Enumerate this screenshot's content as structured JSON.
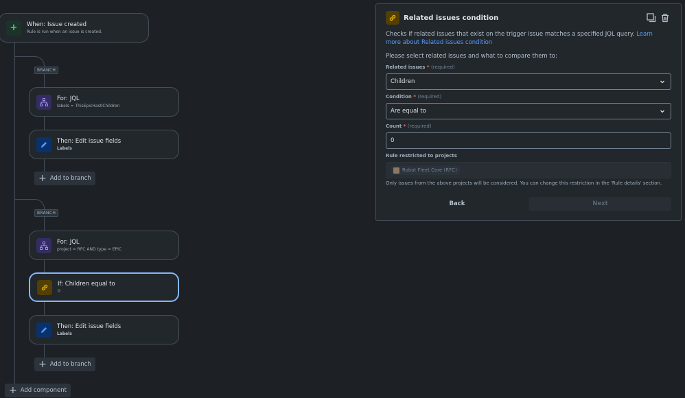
{
  "flow": {
    "trigger": {
      "title": "When: Issue created",
      "subtitle": "Rule is run when an issue is created."
    },
    "branch1": {
      "badge": "BRANCH",
      "for": {
        "title": "For: JQL",
        "subtitle": "labels = ThisEpicHas0Children"
      },
      "then": {
        "title": "Then: Edit issue fields",
        "subtitle": "Labels"
      },
      "add": "Add to branch"
    },
    "branch2": {
      "badge": "BRANCH",
      "for": {
        "title": "For: JQL",
        "subtitle": "project = RFC AND type = EPIC"
      },
      "if": {
        "title": "If: Children equal to",
        "subtitle": "0"
      },
      "then": {
        "title": "Then: Edit issue fields",
        "subtitle": "Labels"
      },
      "add": "Add to branch"
    },
    "add_component": "Add component"
  },
  "panel": {
    "title": "Related issues condition",
    "description": "Checks if related issues that exist on the trigger issue matches a specified JQL query.",
    "learn_more": "Learn more about Related issues condition",
    "prompt": "Please select related issues and what to compare them to:",
    "related_issues": {
      "label": "Related issues",
      "required": "(required)",
      "value": "Children"
    },
    "condition": {
      "label": "Condition",
      "required": "(required)",
      "value": "Are equal to"
    },
    "count": {
      "label": "Count",
      "required": "(required)",
      "value": "0"
    },
    "restricted": {
      "label": "Rule restricted to projects",
      "project": "Robot Fleet Core (RFC)",
      "hint": "Only issues from the above projects will be considered. You can change this restriction in the 'Rule details' section."
    },
    "back": "Back",
    "next": "Next"
  },
  "icons": {
    "trigger": "plus-icon",
    "branch": "hierarchy-icon",
    "action": "pencil-icon",
    "condition": "link-icon",
    "copy": "copy-icon",
    "delete": "trash-icon",
    "dropdown": "chevron-down-icon"
  },
  "colors": {
    "accent": "#579dff",
    "selected": "#85b8ff",
    "condition": "#e2b203",
    "trigger": "#4bce97",
    "branch": "#9f8fef"
  }
}
